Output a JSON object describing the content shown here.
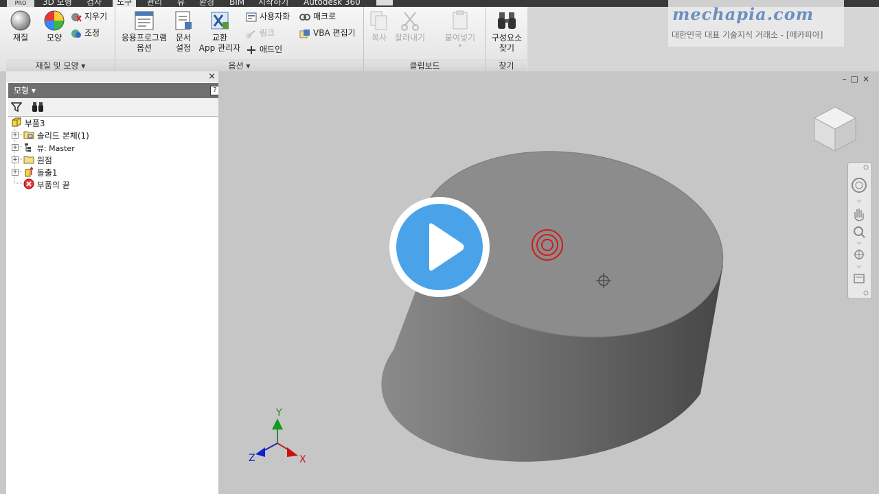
{
  "tabs": {
    "pro_badge": "PRO",
    "items": [
      "3D 모형",
      "검사",
      "도구",
      "관리",
      "뷰",
      "환경",
      "BIM",
      "시작하기",
      "Autodesk 360"
    ],
    "active_index": 2
  },
  "ribbon": {
    "material_panel": {
      "title": "재질 및 모양 ▾",
      "material": "재질",
      "appearance": "모양",
      "clear": "지우기",
      "adjust": "조정"
    },
    "options_panel": {
      "title": "옵션 ▾",
      "app_options": [
        "응용프로그램",
        "옵션"
      ],
      "doc_settings": [
        "문서",
        "설정"
      ],
      "exchange": [
        "교환",
        "App 관리자"
      ],
      "customize": "사용자화",
      "macro": "매크로",
      "link": "링크",
      "vba": "VBA 편집기",
      "addin": "애드인"
    },
    "clipboard_panel": {
      "title": "클립보드",
      "copy": "복사",
      "cut": "잘라내기",
      "paste": "붙여넣기"
    },
    "find_panel": {
      "title": "찾기",
      "find": [
        "구성요소",
        "찾기"
      ]
    }
  },
  "watermark": {
    "logo": "mechapia.com",
    "tagline": "대한민국 대표 기술지식 거래소 - [메카피아]"
  },
  "browser": {
    "title": "모형 ▾",
    "help": "?",
    "close": "×",
    "tree": [
      {
        "label": "부품3",
        "expander": ""
      },
      {
        "label": "솔리드 본체(1)",
        "expander": "+"
      },
      {
        "label": "뷰: Master",
        "expander": "+"
      },
      {
        "label": "원점",
        "expander": "+"
      },
      {
        "label": "돌출1",
        "expander": "+"
      },
      {
        "label": "부품의 끝",
        "expander": ""
      }
    ]
  },
  "viewport": {
    "axes": {
      "x": "X",
      "y": "Y",
      "z": "Z"
    },
    "window_controls": [
      "–",
      "□",
      "×"
    ]
  },
  "colors": {
    "accent": "#4aa3e8",
    "target": "#d11b1b",
    "axis_x": "#cc1111",
    "axis_y": "#119922",
    "axis_z": "#1122cc"
  }
}
